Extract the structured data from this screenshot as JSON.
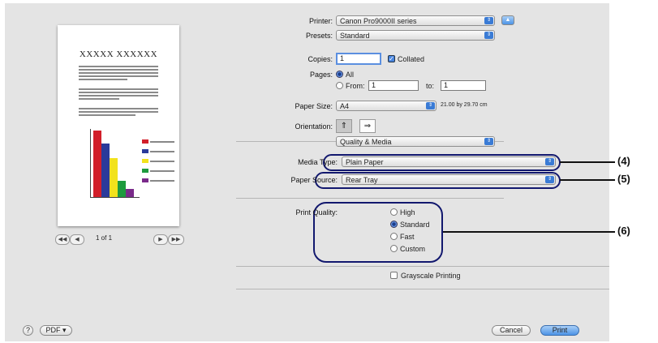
{
  "preview": {
    "title": "XXXXX XXXXXX",
    "page_indicator": "1 of 1",
    "nav_first": "◀◀",
    "nav_prev": "◀",
    "nav_next": "▶",
    "nav_last": "▶▶",
    "chart_colors": [
      "#d21f2a",
      "#2a3a9a",
      "#f2e21c",
      "#1e9a3e",
      "#7a2a8a"
    ]
  },
  "printer": {
    "label": "Printer:",
    "value": "Canon Pro9000II series"
  },
  "presets": {
    "label": "Presets:",
    "value": "Standard"
  },
  "copies": {
    "label": "Copies:",
    "value": "1",
    "collated_label": "Collated",
    "collated": true
  },
  "pages": {
    "label": "Pages:",
    "all_label": "All",
    "from_label": "From:",
    "from_value": "1",
    "to_label": "to:",
    "to_value": "1"
  },
  "paper_size": {
    "label": "Paper Size:",
    "value": "A4",
    "dims": "21.00 by 29.70 cm"
  },
  "orientation": {
    "label": "Orientation:"
  },
  "section_popup": {
    "value": "Quality & Media"
  },
  "media_type": {
    "label": "Media Type:",
    "value": "Plain Paper"
  },
  "paper_source": {
    "label": "Paper Source:",
    "value": "Rear Tray"
  },
  "print_quality": {
    "label": "Print Quality:",
    "options": [
      "High",
      "Standard",
      "Fast",
      "Custom"
    ],
    "selected": "Standard"
  },
  "grayscale": {
    "label": "Grayscale Printing"
  },
  "callouts": {
    "c4": "(4)",
    "c5": "(5)",
    "c6": "(6)"
  },
  "footer": {
    "help": "?",
    "pdf": "PDF ▾",
    "cancel": "Cancel",
    "print": "Print"
  }
}
